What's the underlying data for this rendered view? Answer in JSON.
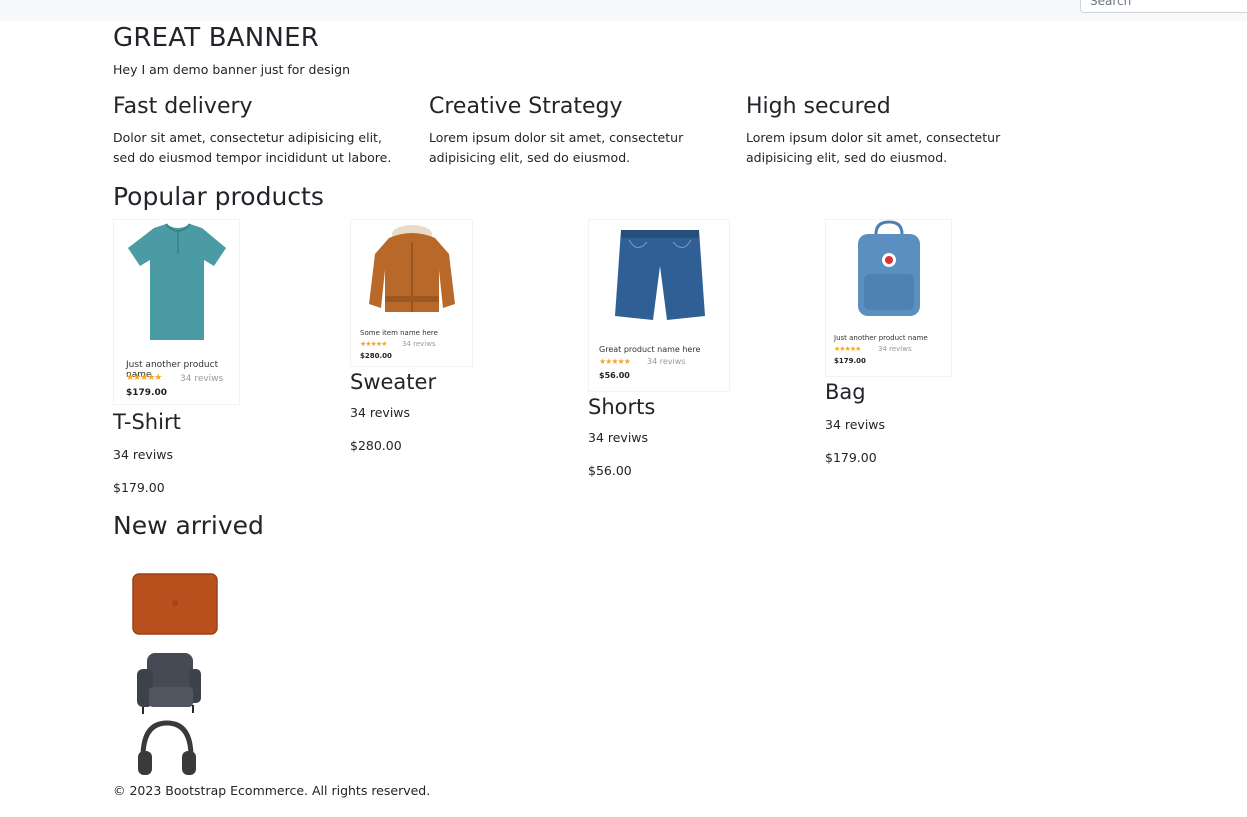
{
  "search": {
    "placeholder": "Search"
  },
  "banner": {
    "title": "GREAT BANNER",
    "subtitle": "Hey I am demo banner just for design"
  },
  "features": [
    {
      "title": "Fast delivery",
      "text": "Dolor sit amet, consectetur adipisicing elit, sed do eiusmod tempor incididunt ut labore."
    },
    {
      "title": "Creative Strategy",
      "text": "Lorem ipsum dolor sit amet, consectetur adipisicing elit, sed do eiusmod."
    },
    {
      "title": "High secured",
      "text": "Lorem ipsum dolor sit amet, consectetur adipisicing elit, sed do eiusmod."
    }
  ],
  "popular": {
    "title": "Popular products",
    "products": [
      {
        "name": "T-Shirt",
        "reviews": "34 reviws",
        "price": "$179.00",
        "image_card": {
          "name": "Just another product name",
          "reviews": "34 reviws",
          "price": "$179.00",
          "stars": "★★★★★"
        },
        "icon": "tshirt-icon"
      },
      {
        "name": "Sweater",
        "reviews": "34 reviws",
        "price": "$280.00",
        "image_card": {
          "name": "Some item name here",
          "reviews": "34 reviws",
          "price": "$280.00",
          "stars": "★★★★★"
        },
        "icon": "jacket-icon"
      },
      {
        "name": "Shorts",
        "reviews": "34 reviws",
        "price": "$56.00",
        "image_card": {
          "name": "Great product name here",
          "reviews": "34 reviws",
          "price": "$56.00",
          "stars": "★★★★★"
        },
        "icon": "shorts-icon"
      },
      {
        "name": "Bag",
        "reviews": "34 reviws",
        "price": "$179.00",
        "image_card": {
          "name": "Just another product name",
          "reviews": "34 reviws",
          "price": "$179.00",
          "stars": "★★★★★"
        },
        "icon": "backpack-icon"
      }
    ]
  },
  "new_arrived": {
    "title": "New arrived",
    "items": [
      {
        "icon": "laptop-sleeve-icon"
      },
      {
        "icon": "armchair-icon"
      },
      {
        "icon": "headphones-icon"
      }
    ]
  },
  "footer": {
    "text": "© 2023 Bootstrap Ecommerce. All rights reserved."
  },
  "colors": {
    "star": "#f5a623",
    "tshirt": "#4a9ba3",
    "jacket": "#b8692a",
    "denim": "#2f5f95",
    "bag": "#5a8fbf",
    "sleeve": "#b9511f",
    "chair": "#454a55",
    "headphones": "#3a3a3a"
  }
}
